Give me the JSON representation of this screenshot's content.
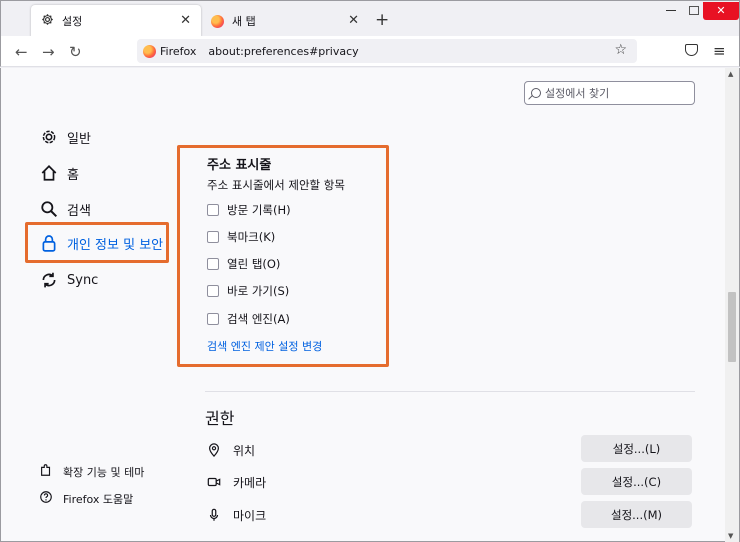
{
  "browser": {
    "active_tab": {
      "label": "설정",
      "icon": "gear-icon"
    },
    "second_tab": {
      "label": "새 탭",
      "icon": "firefox-icon"
    },
    "url_brand": "Firefox",
    "url": "about:preferences#privacy"
  },
  "search": {
    "placeholder": "설정에서 찾기"
  },
  "sidebar": {
    "items": [
      {
        "label": "일반",
        "icon": "gear-icon"
      },
      {
        "label": "홈",
        "icon": "home-icon"
      },
      {
        "label": "검색",
        "icon": "search-icon"
      },
      {
        "label": "개인 정보 및 보안",
        "icon": "lock-icon",
        "selected": true
      },
      {
        "label": "Sync",
        "icon": "sync-icon"
      }
    ],
    "bottom_links": [
      {
        "label": "확장 기능 및 테마",
        "icon": "puzzle-icon"
      },
      {
        "label": "Firefox 도움말",
        "icon": "help-icon"
      }
    ]
  },
  "address_bar": {
    "title": "주소 표시줄",
    "subtitle": "주소 표시줄에서 제안할 항목",
    "options": [
      {
        "label": "방문 기록(H)",
        "checked": false
      },
      {
        "label": "북마크(K)",
        "checked": false
      },
      {
        "label": "열린 탭(O)",
        "checked": false
      },
      {
        "label": "바로 가기(S)",
        "checked": false
      },
      {
        "label": "검색 엔진(A)",
        "checked": false
      }
    ],
    "link": "검색 엔진 제안 설정 변경"
  },
  "permissions": {
    "title": "권한",
    "rows": [
      {
        "label": "위치",
        "icon": "location-icon",
        "button": "설정...(L)"
      },
      {
        "label": "카메라",
        "icon": "camera-icon",
        "button": "설정...(C)"
      },
      {
        "label": "마이크",
        "icon": "microphone-icon",
        "button": "설정...(M)"
      }
    ]
  },
  "colors": {
    "accent": "#0061e0",
    "highlight": "#e56c2e"
  }
}
